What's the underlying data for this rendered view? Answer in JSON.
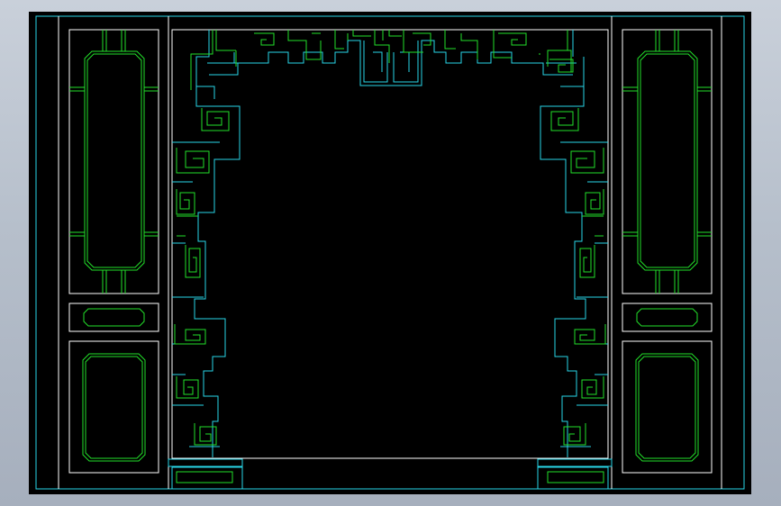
{
  "app": {
    "background": "#b6bfcb",
    "viewport_background": "#000000"
  },
  "colors": {
    "white": "#ffffff",
    "cyan": "#29d6e8",
    "green": "#22e02a"
  },
  "drawing": {
    "subject": "cad-elevation-of-carved-door-arch-with-fret-pattern",
    "layers": [
      "outline-white",
      "frame-cyan",
      "fretwork-green"
    ]
  }
}
